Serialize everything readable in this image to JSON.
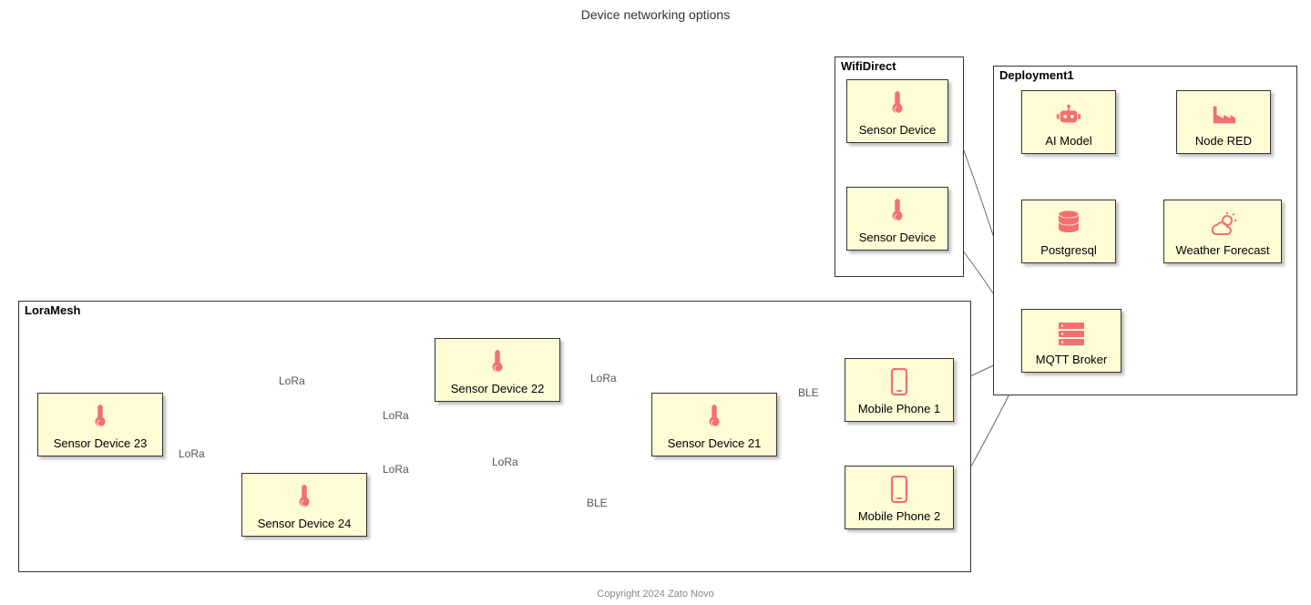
{
  "title": "Device networking options",
  "footer": "Copyright 2024 Zato Novo",
  "packages": {
    "wifi": "WifiDirect",
    "deploy": "Deployment1",
    "lora": "LoraMesh"
  },
  "nodes": {
    "wifi_sensor1": "Sensor Device",
    "wifi_sensor2": "Sensor Device",
    "ai_model": "AI Model",
    "node_red": "Node RED",
    "postgresql": "Postgresql",
    "weather": "Weather Forecast",
    "mqtt": "MQTT Broker",
    "sd21": "Sensor Device 21",
    "sd22": "Sensor Device 22",
    "sd23": "Sensor Device 23",
    "sd24": "Sensor Device 24",
    "mp1": "Mobile Phone 1",
    "mp2": "Mobile Phone 2"
  },
  "edge_labels": {
    "lora1": "LoRa",
    "lora2": "LoRa",
    "lora3": "LoRa",
    "lora4": "LoRa",
    "lora5": "LoRa",
    "lora6": "LoRa",
    "ble1": "BLE",
    "ble2": "BLE"
  }
}
